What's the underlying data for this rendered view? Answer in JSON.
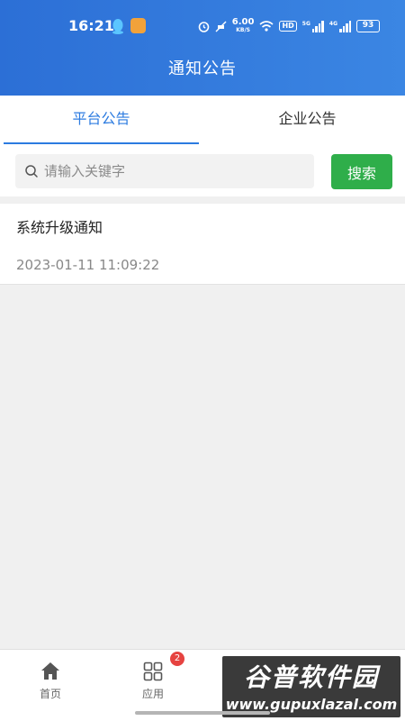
{
  "status_bar": {
    "time": "16:21",
    "net_speed": "6.00",
    "net_unit": "KB/S",
    "hd": "HD",
    "sim1": "5G",
    "sim2": "4G",
    "battery": "93"
  },
  "header": {
    "title": "通知公告"
  },
  "tabs": [
    {
      "label": "平台公告",
      "active": true
    },
    {
      "label": "企业公告",
      "active": false
    }
  ],
  "search": {
    "placeholder": "请输入关键字",
    "value": "",
    "button_label": "搜索"
  },
  "notices": [
    {
      "title": "系统升级通知",
      "time": "2023-01-11 11:09:22"
    }
  ],
  "bottom_nav": [
    {
      "label": "首页",
      "icon": "home-icon"
    },
    {
      "label": "应用",
      "icon": "grid-icon",
      "badge": "2"
    },
    {
      "label": "",
      "icon": "message-icon"
    },
    {
      "label": "",
      "icon": "user-icon"
    }
  ],
  "watermark": {
    "brand": "谷普软件园",
    "url": "www.gupuxlazal.com"
  },
  "colors": {
    "header": "#2c6fd6",
    "accent": "#2c7be0",
    "search_button": "#2fae4a",
    "badge": "#e64340"
  }
}
